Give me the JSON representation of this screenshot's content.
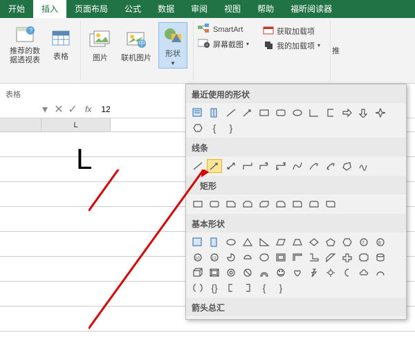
{
  "tabs": [
    "开始",
    "插入",
    "页面布局",
    "公式",
    "数据",
    "审阅",
    "视图",
    "帮助",
    "福昕阅读器"
  ],
  "activeTab": 1,
  "ribbon": {
    "pivot": "推荐的数\n据透视表",
    "table": "表格",
    "pictures": "图片",
    "online": "联机图片",
    "shapes": "形状",
    "smartart": "SmartArt",
    "screenshot": "屏幕截图",
    "getaddins": "获取加载项",
    "myaddins": "我的加载项",
    "groupLabel": "表格"
  },
  "formulaBar": {
    "name": "",
    "fx": "fx",
    "value": "12"
  },
  "sheet": {
    "colL": "L",
    "bigLetter": "L"
  },
  "dropdown": {
    "cat_recent": "最近使用的形状",
    "cat_lines": "线条",
    "cat_rect": "矩形",
    "cat_basic": "基本形状",
    "cat_arrows": "箭头总汇"
  }
}
